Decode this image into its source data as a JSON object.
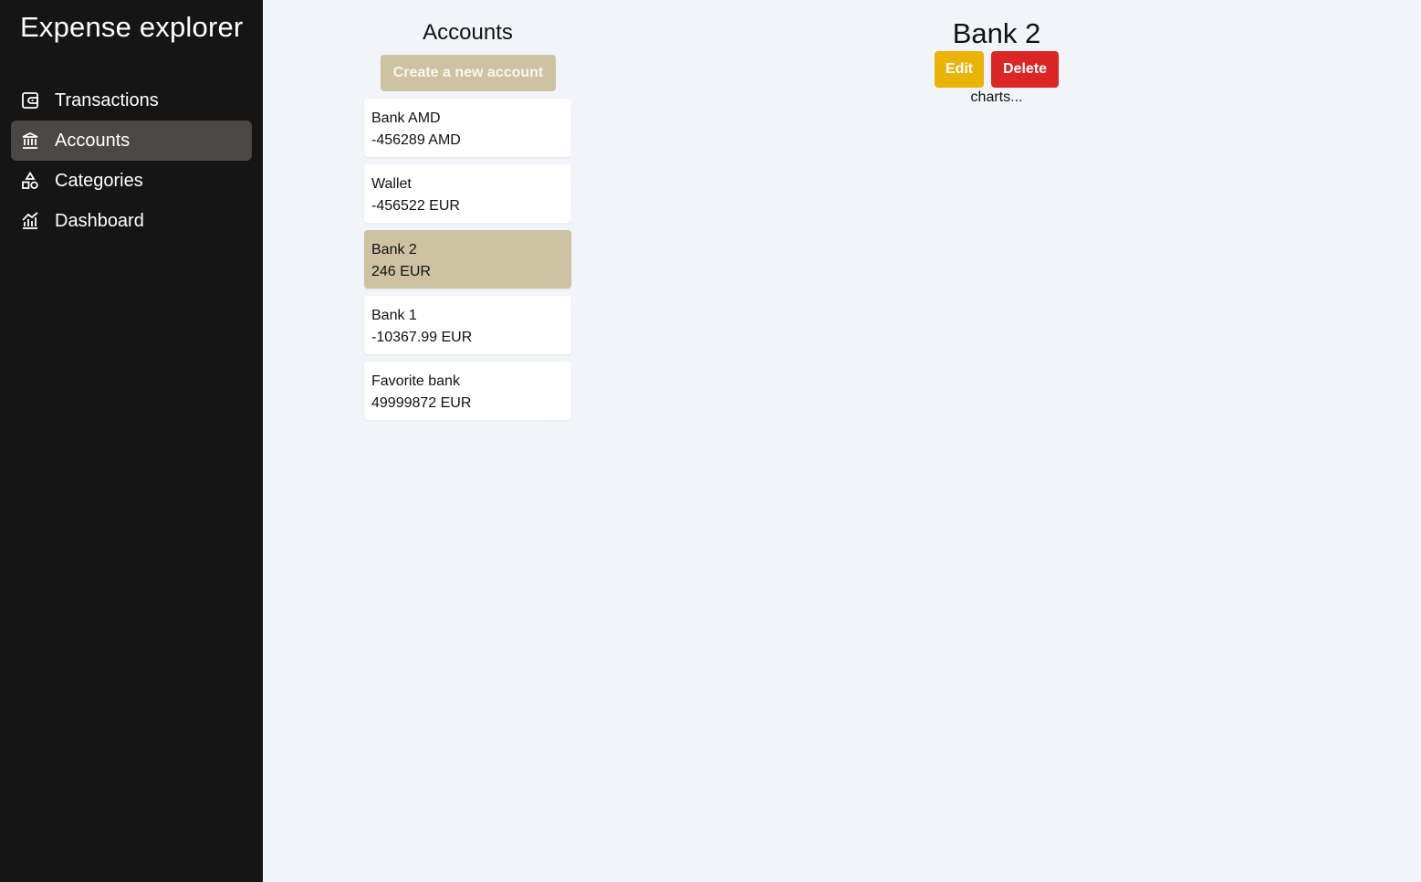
{
  "app": {
    "title": "Expense explorer"
  },
  "sidebar": {
    "items": [
      {
        "label": "Transactions",
        "icon": "wallet-icon",
        "active": false
      },
      {
        "label": "Accounts",
        "icon": "bank-icon",
        "active": true
      },
      {
        "label": "Categories",
        "icon": "shapes-icon",
        "active": false
      },
      {
        "label": "Dashboard",
        "icon": "chart-icon",
        "active": false
      }
    ]
  },
  "accounts": {
    "heading": "Accounts",
    "create_label": "Create a new account",
    "list": [
      {
        "name": "Bank AMD",
        "balance": "-456289 AMD",
        "selected": false
      },
      {
        "name": "Wallet",
        "balance": "-456522 EUR",
        "selected": false
      },
      {
        "name": "Bank 2",
        "balance": "246 EUR",
        "selected": true
      },
      {
        "name": "Bank 1",
        "balance": "-10367.99 EUR",
        "selected": false
      },
      {
        "name": "Favorite bank",
        "balance": "49999872 EUR",
        "selected": false
      }
    ]
  },
  "detail": {
    "title": "Bank 2",
    "edit_label": "Edit",
    "delete_label": "Delete",
    "charts_placeholder": "charts..."
  },
  "colors": {
    "sidebar_bg": "#151515",
    "active_item": "#4a4745",
    "accent": "#cdc2a2",
    "edit": "#eab308",
    "delete": "#dc2626",
    "page_bg": "#f1f5f9"
  }
}
